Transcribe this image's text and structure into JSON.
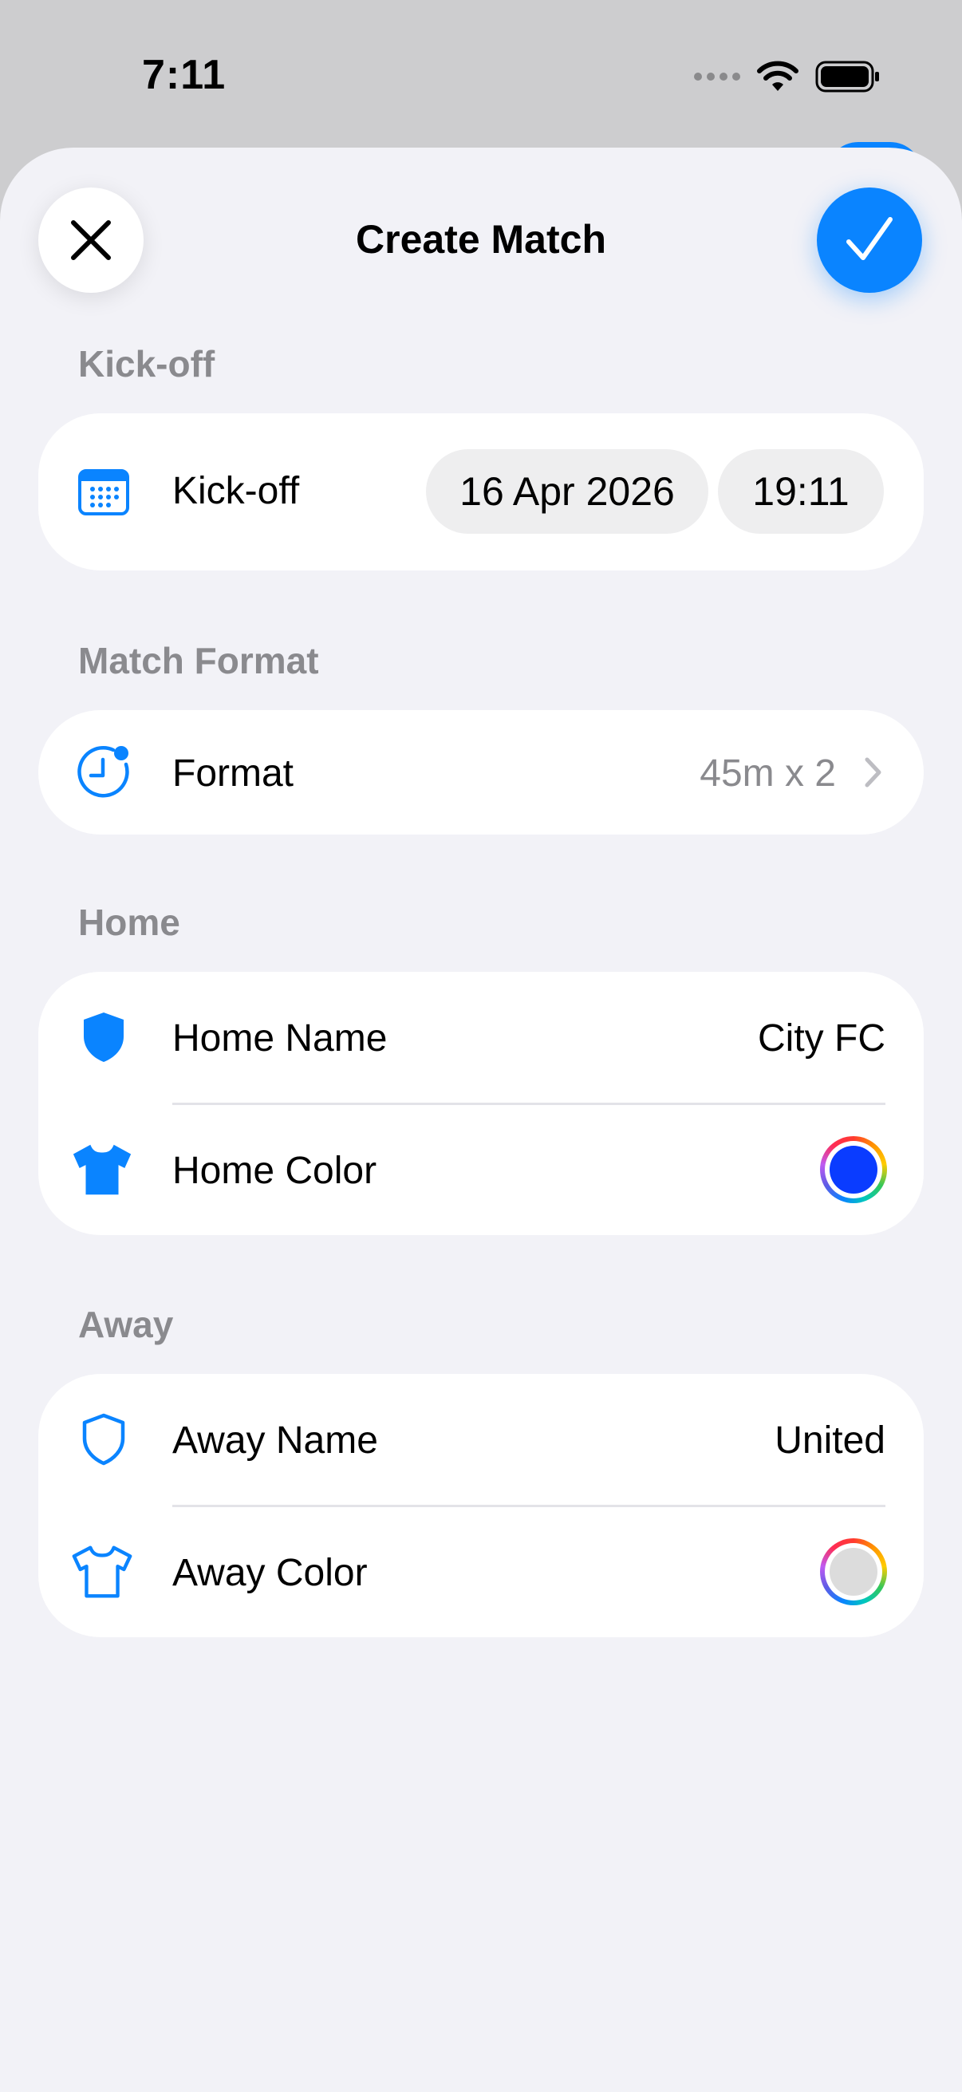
{
  "status_bar": {
    "time": "7:11"
  },
  "header": {
    "title": "Create Match"
  },
  "sections": {
    "kickoff": {
      "header": "Kick-off",
      "row_label": "Kick-off",
      "date": "16 Apr 2026",
      "time": "19:11"
    },
    "format": {
      "header": "Match Format",
      "row_label": "Format",
      "value": "45m x 2"
    },
    "home": {
      "header": "Home",
      "name_label": "Home Name",
      "name_value": "City FC",
      "color_label": "Home Color",
      "color_value": "#0a3cff"
    },
    "away": {
      "header": "Away",
      "name_label": "Away Name",
      "name_value": "United",
      "color_label": "Away Color",
      "color_value": "#dcdcdc"
    }
  },
  "colors": {
    "accent": "#0a84ff",
    "background": "#f2f2f7",
    "muted_text": "#8a8a8e"
  },
  "icons": {
    "close": "xmark-icon",
    "confirm": "checkmark-icon",
    "kickoff": "calendar-icon",
    "format": "clock-badge-icon",
    "home_name": "shield-filled-icon",
    "home_color": "tshirt-filled-icon",
    "away_name": "shield-outline-icon",
    "away_color": "tshirt-outline-icon",
    "chevron": "chevron-right-icon"
  }
}
